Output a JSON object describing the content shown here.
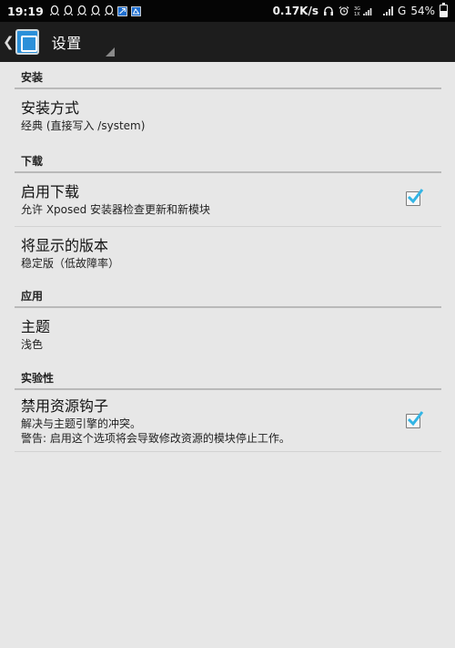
{
  "status_bar": {
    "time": "19:19",
    "left_icons": [
      "qq-icon",
      "qq-icon",
      "qq-icon",
      "qq-icon",
      "qq-icon",
      "notification-box-icon",
      "notification-box-icon"
    ],
    "net_speed": "0.17K/s",
    "network": "G",
    "battery": "54%",
    "battery_level": 54
  },
  "action_bar": {
    "title": "设置"
  },
  "sections": {
    "install": {
      "header": "安装",
      "method_title": "安装方式",
      "method_summary": "经典 (直接写入 /system)"
    },
    "download": {
      "header": "下载",
      "enable_title": "启用下载",
      "enable_summary": "允许 Xposed 安装器检查更新和新模块",
      "enable_checked": true,
      "version_title": "将显示的版本",
      "version_summary": "稳定版（低故障率）"
    },
    "app": {
      "header": "应用",
      "theme_title": "主题",
      "theme_summary": "浅色"
    },
    "experimental": {
      "header": "实验性",
      "hooks_title": "禁用资源钩子",
      "hooks_summary_1": "解决与主题引擎的冲突。",
      "hooks_summary_2": "警告: 启用这个选项将会导致修改资源的模块停止工作。",
      "hooks_checked": true
    }
  },
  "colors": {
    "background": "#e7e7e7",
    "action_bar": "#1d1d1d",
    "status_bar": "#050505",
    "accent_check": "#33b5e5"
  }
}
